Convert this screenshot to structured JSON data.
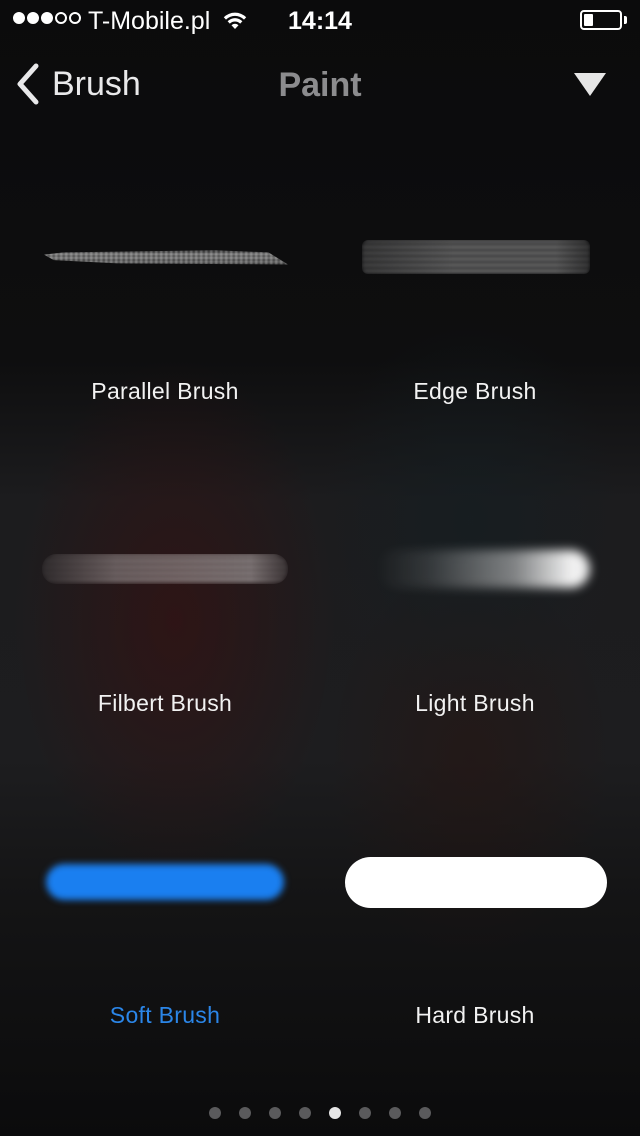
{
  "status_bar": {
    "signal_filled": 3,
    "signal_total": 5,
    "carrier": "T-Mobile.pl",
    "wifi_icon": "wifi-icon",
    "time": "14:14",
    "battery_level": 0.25
  },
  "nav": {
    "back_label": "Brush",
    "title": "Paint",
    "menu_icon": "triangle-down-icon"
  },
  "brushes": [
    {
      "label": "Parallel Brush",
      "selected": false
    },
    {
      "label": "Edge Brush",
      "selected": false
    },
    {
      "label": "Filbert Brush",
      "selected": false
    },
    {
      "label": "Light Brush",
      "selected": false
    },
    {
      "label": "Soft Brush",
      "selected": true,
      "color": "#1a7ff0"
    },
    {
      "label": "Hard Brush",
      "selected": false
    }
  ],
  "pagination": {
    "total": 8,
    "current": 5
  },
  "colors": {
    "accent": "#2b86e8",
    "nav_title": "#8c8c8e",
    "background": "#0c0c0d"
  }
}
